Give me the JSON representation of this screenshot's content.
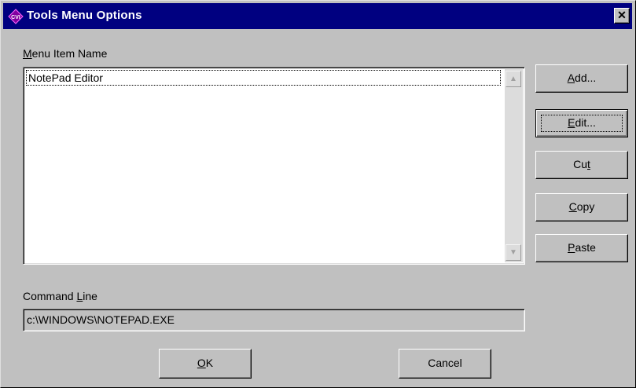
{
  "window": {
    "title": "Tools Menu Options",
    "icon": "cvi-app-icon",
    "close_symbol": "✕"
  },
  "menu_items": {
    "label_prefix": "",
    "label_mnemonic": "M",
    "label_rest": "enu Item Name",
    "items": [
      {
        "label": "NotePad Editor"
      }
    ]
  },
  "buttons": {
    "add": {
      "mnemonic": "A",
      "rest": "dd..."
    },
    "edit": {
      "mnemonic": "E",
      "rest": "dit..."
    },
    "cut": {
      "pre": "Cu",
      "mnemonic": "t",
      "rest": ""
    },
    "copy": {
      "mnemonic": "C",
      "rest": "opy"
    },
    "paste": {
      "mnemonic": "P",
      "rest": "aste"
    }
  },
  "command_line": {
    "label_pre": "Command ",
    "label_mnemonic": "L",
    "label_rest": "ine",
    "value": "c:\\WINDOWS\\NOTEPAD.EXE"
  },
  "footer": {
    "ok": {
      "mnemonic": "O",
      "rest": "K"
    },
    "cancel": "Cancel"
  },
  "colors": {
    "title_bar": "#000080",
    "face": "#c0c0c0",
    "list_bg": "#ffffff"
  }
}
